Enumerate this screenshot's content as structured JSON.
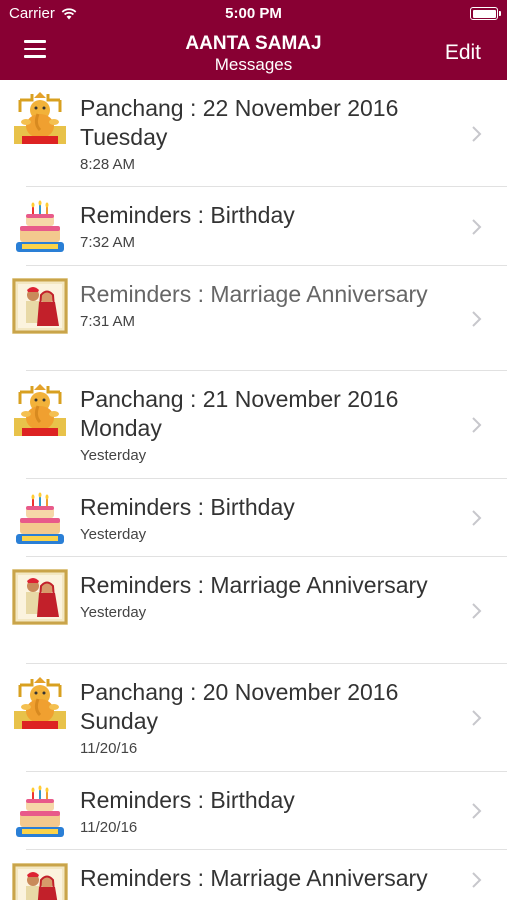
{
  "status_bar": {
    "carrier": "Carrier",
    "time": "5:00 PM",
    "battery_level": 1.0,
    "wifi_icon": "wifi-icon"
  },
  "nav": {
    "menu_icon": "hamburger-icon",
    "title": "AANTA SAMAJ",
    "subtitle": "Messages",
    "edit_label": "Edit"
  },
  "messages": [
    {
      "icon": "ganesha-icon",
      "title": "Panchang : 22 November 2016 Tuesday",
      "time": "8:28 AM"
    },
    {
      "icon": "birthday-cake-icon",
      "title": "Reminders : Birthday",
      "time": "7:32 AM"
    },
    {
      "icon": "wedding-couple-icon",
      "title": "Reminders : Marriage Anniversary",
      "time": "7:31 AM"
    },
    {
      "icon": "ganesha-icon",
      "title": "Panchang : 21 November 2016 Monday",
      "time": "Yesterday"
    },
    {
      "icon": "birthday-cake-icon",
      "title": "Reminders : Birthday",
      "time": "Yesterday"
    },
    {
      "icon": "wedding-couple-icon",
      "title": "Reminders : Marriage Anniversary",
      "time": "Yesterday"
    },
    {
      "icon": "ganesha-icon",
      "title": "Panchang : 20 November 2016 Sunday",
      "time": "11/20/16"
    },
    {
      "icon": "birthday-cake-icon",
      "title": "Reminders : Birthday",
      "time": "11/20/16"
    },
    {
      "icon": "wedding-couple-icon",
      "title": "Reminders : Marriage Anniversary",
      "time": ""
    }
  ],
  "colors": {
    "brand": "#880033",
    "separator": "#e1e1e1",
    "chevron": "#c7c7cc"
  }
}
